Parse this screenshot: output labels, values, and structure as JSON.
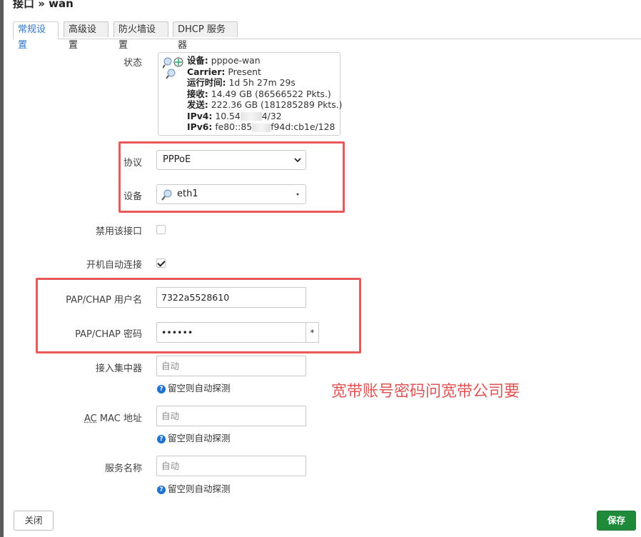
{
  "page_title": "接口 » wan",
  "tabs": [
    {
      "label": "常规设置",
      "active": true
    },
    {
      "label": "高级设置",
      "active": false
    },
    {
      "label": "防火墙设置",
      "active": false
    },
    {
      "label": "DHCP 服务器",
      "active": false
    }
  ],
  "status": {
    "label": "状态",
    "device_key": "设备:",
    "device_val": "pppoe-wan",
    "carrier_key": "Carrier:",
    "carrier_val": "Present",
    "uptime_key": "运行时间:",
    "uptime_val": "1d 5h 27m 29s",
    "rx_key": "接收:",
    "rx_val": "14.49 GB (86566522 Pkts.)",
    "tx_key": "发送:",
    "tx_val": "222.36 GB (181285289 Pkts.)",
    "ipv4_key": "IPv4:",
    "ipv4_val_a": "10.54",
    "ipv4_val_b": "4/32",
    "ipv6_key": "IPv6:",
    "ipv6_val_a": "fe80::85",
    "ipv6_val_b": "f94d:cb1e/128"
  },
  "protocol": {
    "label": "协议",
    "value": "PPPoE"
  },
  "device": {
    "label": "设备",
    "value": "eth1"
  },
  "disable_iface": {
    "label": "禁用该接口",
    "checked": false
  },
  "auto_connect": {
    "label": "开机自动连接",
    "checked": true
  },
  "username": {
    "label": "PAP/CHAP 用户名",
    "value": "7322a5528610"
  },
  "password": {
    "label": "PAP/CHAP 密码",
    "value": "••••••",
    "reveal": "*"
  },
  "concentrator": {
    "label": "接入集中器",
    "placeholder": "自动",
    "hint": "留空则自动探测"
  },
  "ac_mac": {
    "label_ac": "AC",
    "label_rest": " MAC 地址",
    "placeholder": "自动",
    "hint": "留空则自动探测"
  },
  "service_name": {
    "label": "服务名称",
    "placeholder": "自动",
    "hint": "留空则自动探测"
  },
  "annotation": "宽带账号密码问宽带公司要",
  "buttons": {
    "close": "关闭",
    "save": "保存"
  },
  "colors": {
    "accent": "#3277c8",
    "save": "#1e8a3a",
    "highlight": "#e85a5a"
  }
}
